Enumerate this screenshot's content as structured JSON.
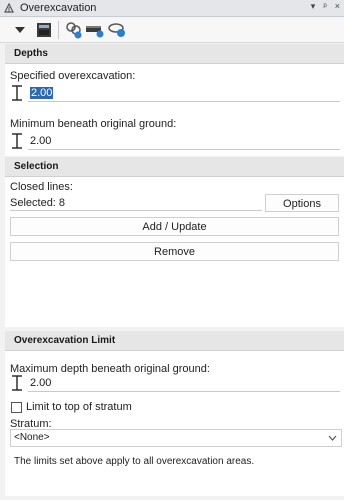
{
  "window": {
    "title": "Overexcavation",
    "controls": [
      "▾",
      "ᵖ",
      "×"
    ]
  },
  "toolbar": {
    "buttons": [
      "dropdown-arrow-icon",
      "properties-icon",
      "select-lines-icon",
      "create-surface-icon",
      "link-update-icon"
    ]
  },
  "depths": {
    "header": "Depths",
    "specified_label": "Specified overexcavation:",
    "specified_value": "2.00",
    "minimum_label": "Minimum beneath original ground:",
    "minimum_value": "2.00"
  },
  "selection": {
    "header": "Selection",
    "closed_lines_label": "Closed lines:",
    "selected_text": "Selected: 8",
    "options_label": "Options",
    "add_update_label": "Add / Update",
    "remove_label": "Remove"
  },
  "limit": {
    "header": "Overexcavation Limit",
    "max_depth_label": "Maximum depth beneath original ground:",
    "max_depth_value": "2.00",
    "limit_checkbox_label": "Limit to top of stratum",
    "limit_checked": false,
    "stratum_label": "Stratum:",
    "stratum_value": "<None>",
    "note": "The limits set above apply to all overexcavation areas."
  },
  "colors": {
    "selection_highlight": "#2b67b3",
    "section_header_bg": "#e6e6e6",
    "panel_bg": "#ffffff"
  }
}
